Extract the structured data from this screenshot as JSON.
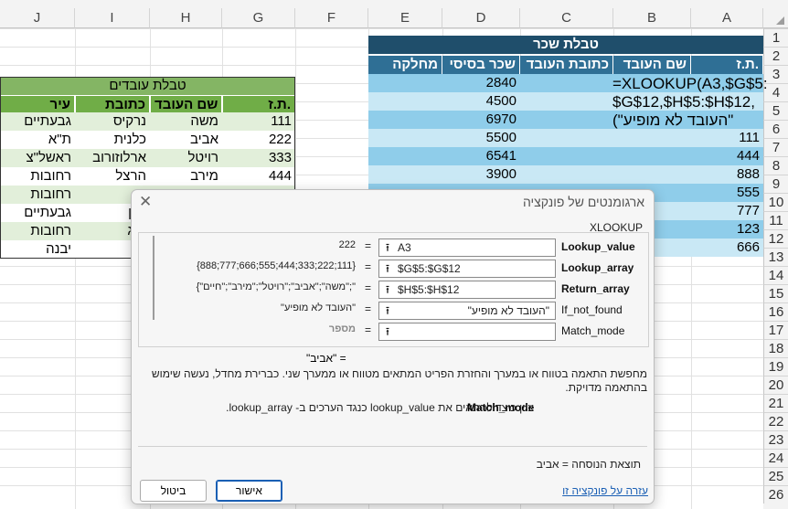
{
  "columns": [
    "J",
    "I",
    "H",
    "G",
    "F",
    "E",
    "D",
    "C",
    "B",
    "A"
  ],
  "rows": [
    "1",
    "2",
    "3",
    "4",
    "5",
    "6",
    "7",
    "8",
    "9",
    "10",
    "11",
    "12",
    "13",
    "14",
    "15",
    "16",
    "17",
    "18",
    "19",
    "20",
    "21",
    "22",
    "23",
    "24",
    "25",
    "26"
  ],
  "salary_table": {
    "title": "טבלת שכר",
    "headers": [
      "ת.ז.",
      "שם העובד",
      "כתובת העובד",
      "שכר בסיסי",
      "מחלקה"
    ],
    "ids": [
      "",
      "",
      "",
      "111",
      "444",
      "888",
      "555",
      "777",
      "123",
      "666"
    ],
    "salaries": [
      "2840",
      "4500",
      "6970",
      "5500",
      "6541",
      "3900",
      "",
      "",
      "",
      ""
    ],
    "formula_lines": [
      "=XLOOKUP(A3,$G$5:",
      "$G$12,$H$5:$H$12,",
      "\"העובד לא מופיע\")"
    ]
  },
  "employees_table": {
    "title": "טבלת עובדים",
    "headers": [
      "ת.ז.",
      "שם העובד",
      "כתובת",
      "עיר"
    ],
    "rows": [
      [
        "111",
        "משה",
        "נרקיס",
        "גבעתיים"
      ],
      [
        "222",
        "אביב",
        "כלנית",
        "ת\"א"
      ],
      [
        "333",
        "רויטל",
        "ארלוזורוב",
        "ראשל\"צ"
      ],
      [
        "444",
        "מירב",
        "הרצל",
        "רחובות"
      ],
      [
        "",
        "",
        "ית",
        "רחובות"
      ],
      [
        "",
        "",
        "ציון",
        "גבעתיים"
      ],
      [
        "",
        "",
        "מוג",
        "רחובות"
      ],
      [
        "",
        "",
        "ית",
        "יבנה"
      ]
    ]
  },
  "dialog": {
    "title": "ארגומנטים של פונקציה",
    "function_name": "XLOOKUP",
    "args": [
      {
        "label": "Lookup_value",
        "input": "A3",
        "value": "222",
        "bold": true
      },
      {
        "label": "Lookup_array",
        "input": "$G$5:$G$12",
        "value": "{888;777;666;555;444;333;222;111}",
        "bold": true
      },
      {
        "label": "Return_array",
        "input": "$H$5:$H$12",
        "value": "{\"משה\";\"אביב\";\"רויטל\";\"מירב\";\"חיים\";\"",
        "bold": true
      },
      {
        "label": "If_not_found",
        "input": "\"העובד לא מופיע\"",
        "value": "\"העובד לא מופיע\"",
        "bold": false
      },
      {
        "label": "Match_mode",
        "input": "",
        "value": "מספר",
        "bold": false
      }
    ],
    "equals": "=",
    "result_preview": "\"אביב\"  =",
    "description": "מחפשת התאמה בטווח או במערך והחזרת הפריט המתאים מטווח או ממערך שני. כברירת מחדל, נעשה שימוש בהתאמה מדויקת.",
    "arg_help_name": "Match_mode",
    "arg_help_text": "ציין כיצד להתאים את lookup_value כנגד הערכים ב- lookup_array.",
    "result_label": "תוצאת הנוסחה =  אביב",
    "help_link": "עזרה על פונקציה זו",
    "ok_label": "אישור",
    "cancel_label": "ביטול"
  },
  "colors": {
    "salary_title": "#1f4e6b",
    "salary_header": "#2f6f95",
    "salary_band": "#8fcdea",
    "employees_header": "#70ad47",
    "employees_band": "#e2efda"
  }
}
